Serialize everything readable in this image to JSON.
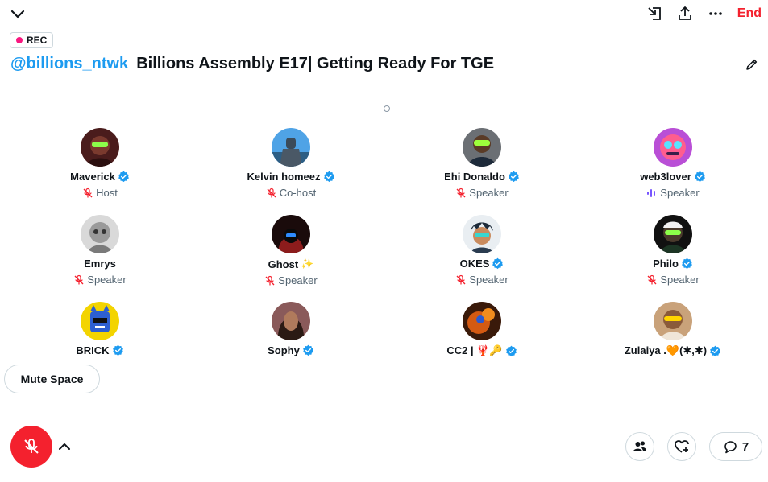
{
  "header": {
    "end_label": "End",
    "icons": [
      "chevron-down-icon",
      "dock-icon",
      "share-icon",
      "more-icon"
    ]
  },
  "rec_badge": {
    "label": "REC",
    "dot_color": "#f91880"
  },
  "space": {
    "host_handle": "@billions_ntwk",
    "title": "Billions Assembly E17| Getting Ready For TGE"
  },
  "speakers": [
    {
      "name": "Maverick",
      "verified": true,
      "role": "Host",
      "status": "muted",
      "emoji": ""
    },
    {
      "name": "Kelvin homeez",
      "verified": true,
      "role": "Co-host",
      "status": "muted",
      "emoji": ""
    },
    {
      "name": "Ehi Donaldo",
      "verified": true,
      "role": "Speaker",
      "status": "muted",
      "emoji": ""
    },
    {
      "name": "web3lover",
      "verified": true,
      "role": "Speaker",
      "status": "speaking",
      "emoji": ""
    },
    {
      "name": "Emrys",
      "verified": false,
      "role": "Speaker",
      "status": "muted",
      "emoji": ""
    },
    {
      "name": "Ghost",
      "verified": false,
      "role": "Speaker",
      "status": "muted",
      "emoji": "✨"
    },
    {
      "name": "OKES",
      "verified": true,
      "role": "Speaker",
      "status": "muted",
      "emoji": ""
    },
    {
      "name": "Philo",
      "verified": true,
      "role": "Speaker",
      "status": "muted",
      "emoji": ""
    },
    {
      "name": "BRICK",
      "verified": true,
      "role": "",
      "status": "hidden",
      "emoji": ""
    },
    {
      "name": "Sophy",
      "verified": true,
      "role": "",
      "status": "hidden",
      "emoji": ""
    },
    {
      "name": "CC2 | 🦞🔑",
      "verified": true,
      "role": "",
      "status": "hidden",
      "emoji": ""
    },
    {
      "name": "Zulaiya .🧡(✱,✱)",
      "verified": true,
      "role": "",
      "status": "hidden",
      "emoji": ""
    }
  ],
  "controls": {
    "mute_space_label": "Mute Space",
    "comments_count": "7",
    "icons": [
      "mic-off-icon",
      "chevron-up-icon",
      "people-icon",
      "heart-plus-icon",
      "comment-icon"
    ]
  },
  "colors": {
    "accent": "#1d9bf0",
    "end": "#f4212e",
    "muted_icon": "#f4212e",
    "speaking": "#7856ff",
    "secondary_text": "#536471",
    "border": "#cfd9de"
  }
}
